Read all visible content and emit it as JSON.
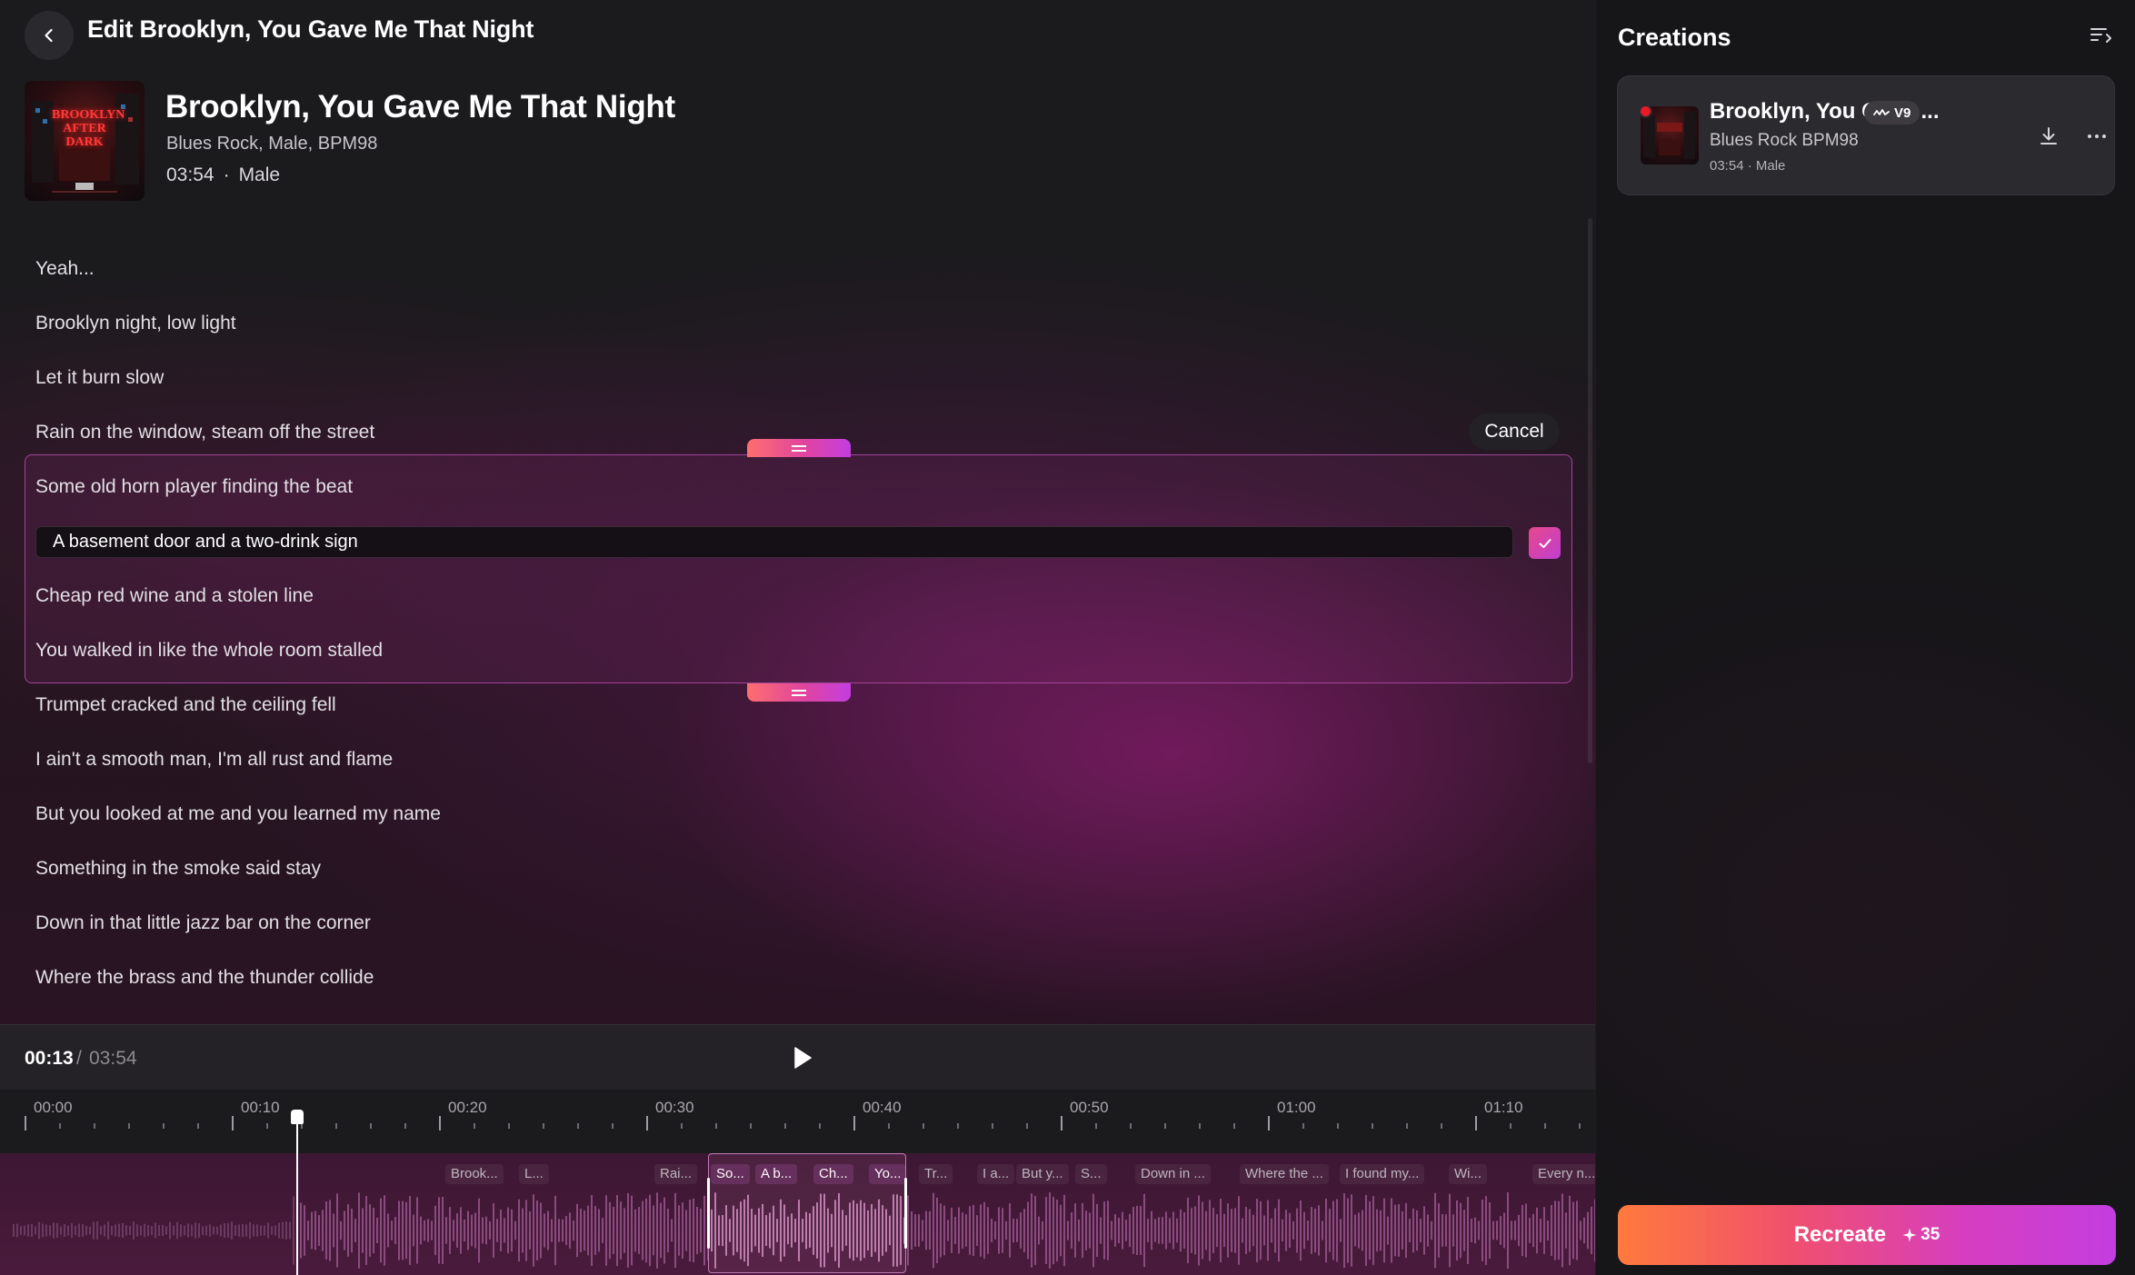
{
  "header": {
    "title": "Edit Brooklyn, You Gave Me That Night"
  },
  "song": {
    "title": "Brooklyn, You Gave Me That Night",
    "tags": "Blues Rock, Male, BPM98",
    "duration": "03:54",
    "voice": "Male",
    "cover_text": "BROOKLYN AFTER DARK"
  },
  "lyrics": {
    "lines": [
      "Yeah...",
      "Brooklyn night, low light",
      "Let it burn slow",
      "Rain on the window, steam off the street",
      "Some old horn player finding the beat",
      "A basement door and a two-drink sign",
      "Cheap red wine and a stolen line",
      "You walked in like the whole room stalled",
      "Trumpet cracked and the ceiling fell",
      "I ain't a smooth man, I'm all rust and flame",
      "But you looked at me and you learned my name",
      "Something in the smoke said stay",
      "Down in that little jazz bar on the corner",
      "Where the brass and the thunder collide"
    ],
    "editing_value": "A basement door and a two-drink sign",
    "cancel_label": "Cancel"
  },
  "player": {
    "current": "00:13",
    "separator": "/",
    "total": "03:54",
    "progress_fraction": 0.0556
  },
  "timeline": {
    "ticks": [
      "00:00",
      "00:10",
      "00:20",
      "00:30",
      "00:40",
      "00:50",
      "01:00",
      "01:10"
    ],
    "chips": [
      {
        "label": "Brook...",
        "active": false
      },
      {
        "label": "L...",
        "active": false
      },
      {
        "label": "Rai...",
        "active": false
      },
      {
        "label": "So...",
        "active": true
      },
      {
        "label": "A b...",
        "active": true
      },
      {
        "label": "Ch...",
        "active": true
      },
      {
        "label": "Yo...",
        "active": true
      },
      {
        "label": "Tr...",
        "active": false
      },
      {
        "label": "I a...",
        "active": false
      },
      {
        "label": "But y...",
        "active": false
      },
      {
        "label": "S...",
        "active": false
      },
      {
        "label": "Down in ...",
        "active": false
      },
      {
        "label": "Where the ...",
        "active": false
      },
      {
        "label": "I found my...",
        "active": false
      },
      {
        "label": "Wi...",
        "active": false
      },
      {
        "label": "Every n...",
        "active": false
      }
    ]
  },
  "sidebar": {
    "title": "Creations",
    "card": {
      "title": "Brooklyn, You Gave ...",
      "badge": "V9",
      "subtitle": "Blues Rock BPM98",
      "meta": "03:54 · Male"
    },
    "recreate_label": "Recreate",
    "recreate_cost": "35"
  },
  "colors": {
    "accent_pink": "#e0449f",
    "accent_purple": "#c33ee0",
    "accent_orange": "#ff7a3d",
    "live_dot": "#e81a28"
  },
  "icons": {
    "back": "chevron-left-icon",
    "play": "play-icon",
    "confirm": "check-icon",
    "sort": "sort-icon",
    "download": "download-icon",
    "more": "more-horizontal-icon",
    "waveform_badge": "waveform-icon",
    "sparkle": "sparkle-icon"
  }
}
